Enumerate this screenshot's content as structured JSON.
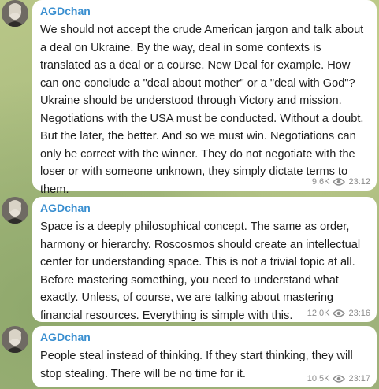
{
  "messages": [
    {
      "author": "AGDchan",
      "text": "We should not accept the crude American jargon and talk about a deal on Ukraine. By the way, deal in some contexts is translated as a deal or a course. New Deal for example. How can one conclude a \"deal about mother\" or a \"deal with God\"?\nUkraine should be understood through Victory and mission. Negotiations with the USA must be conducted. Without a doubt. But the later, the better. And so we must win. Negotiations can only be correct with the winner. They do not negotiate with the loser or with someone unknown, they simply dictate terms to them.",
      "views": "9.6K",
      "time": "23:12"
    },
    {
      "author": "AGDchan",
      "text": "Space is a deeply philosophical concept. The same as order, harmony or hierarchy. Roscosmos should create an intellectual center for understanding space. This is not a trivial topic at all. Before mastering something, you need to understand what exactly. Unless, of course, we are talking about mastering financial resources. Everything is simple with this.",
      "views": "12.0K",
      "time": "23:16"
    },
    {
      "author": "AGDchan",
      "text": "People steal instead of thinking. If they start thinking, they will stop stealing. There will be no time for it.",
      "views": "10.5K",
      "time": "23:17"
    }
  ]
}
